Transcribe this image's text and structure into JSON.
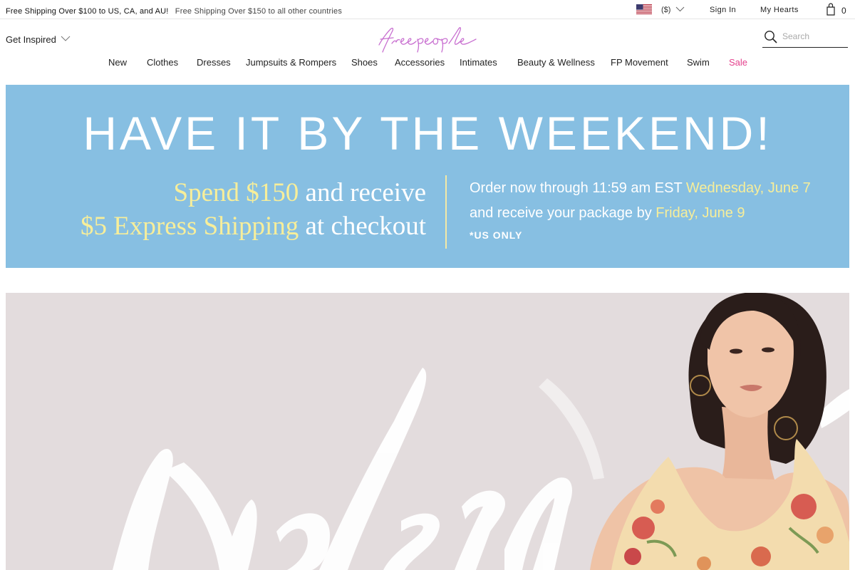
{
  "topbar": {
    "promo_primary": "Free Shipping Over $100 to US, CA, and AU!",
    "promo_secondary": "Free Shipping Over $150 to all other countries",
    "currency": "($)",
    "sign_in": "Sign In",
    "my_hearts": "My Hearts",
    "bag_count": "0"
  },
  "header": {
    "get_inspired": "Get Inspired",
    "logo_text": "free people",
    "search_placeholder": "Search"
  },
  "nav": {
    "items": [
      "New",
      "Clothes",
      "Dresses",
      "Jumpsuits & Rompers",
      "Shoes",
      "Accessories",
      "Intimates",
      "Beauty & Wellness",
      "FP Movement",
      "Swim",
      "Sale"
    ]
  },
  "banner": {
    "headline": "HAVE IT BY THE WEEKEND!",
    "offer_line1_yellow": "Spend $150",
    "offer_line1_white": " and receive",
    "offer_line2_yellow": "$5 Express Shipping",
    "offer_line2_white": " at checkout",
    "detail1_white": "Order now through 11:59 am EST ",
    "detail1_yellow": "Wednesday, June 7",
    "detail2_white": "and receive your package by ",
    "detail2_yellow": "Friday, June 9",
    "detail3": "*US ONLY"
  },
  "hero": {
    "script_text": "Modern"
  },
  "colors": {
    "accent_sale": "#e4408c",
    "logo": "#c86fd0",
    "banner_bg": "#87bfe2",
    "banner_yellow": "#f7ee9a",
    "hero_bg": "#e3dcdd"
  }
}
